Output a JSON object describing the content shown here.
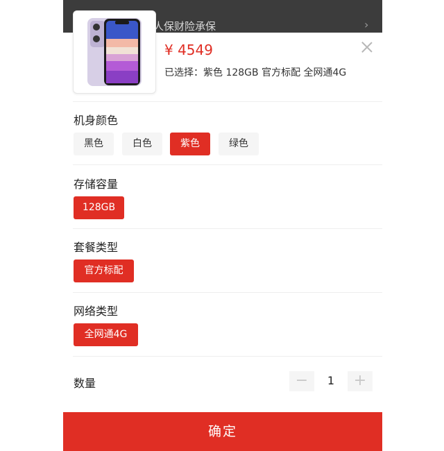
{
  "background_banner": {
    "text": "人保财险承保",
    "chevron": "chevron-right-icon"
  },
  "product": {
    "price": "¥ 4549",
    "selected_text": "已选择：紫色 128GB 官方标配 全网通4G",
    "image": "phone-purple-icon"
  },
  "sections": {
    "color": {
      "title": "机身颜色",
      "options": [
        "黑色",
        "白色",
        "紫色",
        "绿色"
      ],
      "selected": "紫色"
    },
    "storage": {
      "title": "存储容量",
      "options": [
        "128GB"
      ],
      "selected": "128GB"
    },
    "package": {
      "title": "套餐类型",
      "options": [
        "官方标配"
      ],
      "selected": "官方标配"
    },
    "network": {
      "title": "网络类型",
      "options": [
        "全网通4G"
      ],
      "selected": "全网通4G"
    }
  },
  "quantity": {
    "label": "数量",
    "value": "1",
    "minus": "−",
    "plus": "+"
  },
  "confirm_label": "确定",
  "colors": {
    "accent": "#e02e24",
    "chip_bg": "#f5f5f5"
  }
}
